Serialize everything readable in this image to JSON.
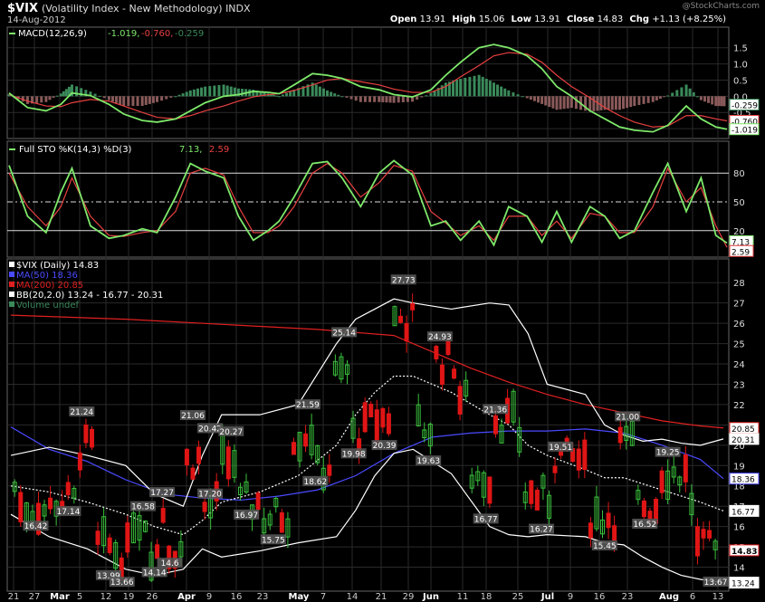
{
  "header": {
    "symbol": "$VIX",
    "name": "(Volatility Index - New Methodology)",
    "exchange": "INDX",
    "date": "14-Aug-2012",
    "open_label": "Open",
    "open": "13.91",
    "high_label": "High",
    "high": "15.06",
    "low_label": "Low",
    "low": "13.91",
    "close_label": "Close",
    "close": "14.83",
    "chg_label": "Chg",
    "chg": "+1.13 (+8.25%)",
    "watermark": "@StockCharts.com"
  },
  "macd_panel": {
    "label": "MACD(12,26,9)",
    "v1": "-1.019,",
    "v2": "-0.760,",
    "v3": "-0.259",
    "ticks": [
      "1.5",
      "1.0",
      "0.5",
      "0.0",
      "-0.5",
      "-1.0"
    ],
    "tags": [
      "-0.259",
      "-0.760",
      "-1.019"
    ]
  },
  "sto_panel": {
    "label": "Full STO %K(14,3) %D(3)",
    "v1": "7.13,",
    "v2": "2.59",
    "ticks": [
      "80",
      "50",
      "20"
    ],
    "tags": [
      "7.13",
      "2.59"
    ]
  },
  "price_panel": {
    "legend": [
      "$VIX (Daily) 14.83",
      "MA(50) 18.36",
      "MA(200) 20.85",
      "BB(20,2.0) 13.24 - 16.77 - 20.31",
      "Volume undef"
    ],
    "tags": [
      "20.85",
      "20.31",
      "18.36",
      "16.77",
      "14.83",
      "13.24"
    ]
  },
  "x_labels": [
    "21",
    "27",
    "Mar",
    "5",
    "12",
    "19",
    "26",
    "Apr",
    "9",
    "16",
    "23",
    "May",
    "7",
    "14",
    "21",
    "29",
    "Jun",
    "11",
    "18",
    "25",
    "Jul",
    "9",
    "16",
    "23",
    "Aug",
    "6",
    "13"
  ],
  "colors": {
    "up": "#39c03b",
    "down": "#e01515",
    "macd": "#7ee86a",
    "signal": "#e84040",
    "ma50": "#4a4aff",
    "ma200": "#e02020",
    "bb": "#ffffff",
    "hist": "#3a8a5a"
  },
  "chart_data": [
    {
      "type": "line",
      "title": "MACD(12,26,9)",
      "x": [
        0,
        5,
        10,
        14,
        17,
        22,
        27,
        31,
        36,
        40,
        45,
        49,
        53,
        58,
        62,
        66,
        70,
        73,
        77,
        82,
        86,
        90,
        95,
        100,
        104,
        109,
        114,
        118,
        122,
        127,
        131,
        135,
        140,
        144,
        148,
        152,
        157,
        161,
        165,
        169,
        174,
        178,
        183,
        187,
        191,
        194
      ],
      "series": [
        {
          "name": "MACD",
          "values": [
            0.1,
            -0.35,
            -0.45,
            -0.25,
            0.1,
            0.02,
            -0.25,
            -0.55,
            -0.75,
            -0.8,
            -0.7,
            -0.45,
            -0.2,
            0.0,
            0.05,
            0.15,
            0.12,
            0.08,
            0.35,
            0.7,
            0.65,
            0.55,
            0.3,
            0.2,
            0.05,
            -0.02,
            0.2,
            0.65,
            1.05,
            1.5,
            1.6,
            1.5,
            1.25,
            0.85,
            0.3,
            0.0,
            -0.45,
            -0.7,
            -0.95,
            -1.05,
            -1.1,
            -0.9,
            -0.3,
            -0.7,
            -0.95,
            -1.019
          ]
        },
        {
          "name": "Signal",
          "values": [
            0.05,
            -0.15,
            -0.3,
            -0.32,
            -0.2,
            -0.1,
            -0.15,
            -0.3,
            -0.5,
            -0.65,
            -0.7,
            -0.6,
            -0.45,
            -0.3,
            -0.15,
            -0.02,
            0.05,
            0.08,
            0.18,
            0.35,
            0.5,
            0.55,
            0.45,
            0.35,
            0.22,
            0.12,
            0.12,
            0.3,
            0.6,
            0.95,
            1.25,
            1.35,
            1.3,
            1.05,
            0.65,
            0.3,
            -0.05,
            -0.35,
            -0.6,
            -0.8,
            -0.95,
            -0.92,
            -0.6,
            -0.6,
            -0.7,
            -0.76
          ]
        }
      ],
      "ylim": [
        -1.25,
        1.8
      ]
    },
    {
      "type": "line",
      "title": "Full STO %K(14,3) %D(3)",
      "x": [
        0,
        5,
        10,
        14,
        17,
        22,
        27,
        31,
        36,
        40,
        45,
        49,
        53,
        58,
        62,
        66,
        70,
        73,
        77,
        82,
        86,
        90,
        95,
        100,
        104,
        109,
        114,
        118,
        122,
        127,
        131,
        135,
        140,
        144,
        148,
        152,
        157,
        161,
        165,
        169,
        174,
        178,
        183,
        187,
        191,
        194
      ],
      "series": [
        {
          "name": "%K",
          "values": [
            88,
            35,
            18,
            60,
            85,
            25,
            12,
            15,
            22,
            18,
            55,
            90,
            82,
            75,
            35,
            10,
            20,
            30,
            55,
            90,
            92,
            75,
            45,
            80,
            93,
            78,
            25,
            30,
            10,
            30,
            5,
            45,
            35,
            8,
            40,
            8,
            45,
            35,
            12,
            20,
            60,
            90,
            40,
            75,
            15,
            7.13
          ]
        },
        {
          "name": "%D",
          "values": [
            80,
            45,
            25,
            45,
            75,
            35,
            15,
            14,
            18,
            20,
            40,
            80,
            85,
            78,
            45,
            18,
            18,
            25,
            45,
            80,
            90,
            80,
            55,
            70,
            88,
            82,
            40,
            28,
            15,
            25,
            10,
            35,
            35,
            15,
            30,
            12,
            38,
            35,
            18,
            18,
            45,
            85,
            50,
            65,
            25,
            2.59
          ]
        }
      ],
      "ylim": [
        0,
        100
      ]
    },
    {
      "type": "candlestick",
      "title": "$VIX (Daily) 14.83",
      "x_ticks": [
        "21",
        "27",
        "Mar",
        "5",
        "12",
        "19",
        "26",
        "Apr",
        "9",
        "16",
        "23",
        "May",
        "7",
        "14",
        "21",
        "29",
        "Jun",
        "11",
        "18",
        "25",
        "Jul",
        "9",
        "16",
        "23",
        "Aug",
        "6",
        "13"
      ],
      "annotations": [
        {
          "label": "21.24",
          "x": 37,
          "y": 21.24
        },
        {
          "label": "17.14",
          "x": 30,
          "y": 17.14
        },
        {
          "label": "16.42",
          "x": 13,
          "y": 16.42
        },
        {
          "label": "13.99",
          "x": 51,
          "y": 13.99
        },
        {
          "label": "13.66",
          "x": 58,
          "y": 13.66
        },
        {
          "label": "16.58",
          "x": 69,
          "y": 16.58
        },
        {
          "label": "14.14",
          "x": 75,
          "y": 14.14
        },
        {
          "label": "17.27",
          "x": 79,
          "y": 17.27
        },
        {
          "label": "14.6",
          "x": 83,
          "y": 14.6
        },
        {
          "label": "21.06",
          "x": 95,
          "y": 21.06
        },
        {
          "label": "17.20",
          "x": 104,
          "y": 17.2
        },
        {
          "label": "20.42",
          "x": 104,
          "y": 20.42
        },
        {
          "label": "20.27",
          "x": 115,
          "y": 20.27
        },
        {
          "label": "16.97",
          "x": 123,
          "y": 16.97
        },
        {
          "label": "15.75",
          "x": 137,
          "y": 15.75
        },
        {
          "label": "21.59",
          "x": 155,
          "y": 21.59
        },
        {
          "label": "18.62",
          "x": 159,
          "y": 18.62
        },
        {
          "label": "19.98",
          "x": 179,
          "y": 19.98
        },
        {
          "label": "25.14",
          "x": 174,
          "y": 25.14
        },
        {
          "label": "20.39",
          "x": 195,
          "y": 20.39
        },
        {
          "label": "27.73",
          "x": 205,
          "y": 27.73
        },
        {
          "label": "24.93",
          "x": 224,
          "y": 24.93
        },
        {
          "label": "19.63",
          "x": 218,
          "y": 19.63
        },
        {
          "label": "16.77",
          "x": 248,
          "y": 16.77
        },
        {
          "label": "21.36",
          "x": 253,
          "y": 21.36
        },
        {
          "label": "16.27",
          "x": 277,
          "y": 16.27
        },
        {
          "label": "19.51",
          "x": 287,
          "y": 19.51
        },
        {
          "label": "15.45",
          "x": 310,
          "y": 15.45
        },
        {
          "label": "21.00",
          "x": 322,
          "y": 21.0
        },
        {
          "label": "16.52",
          "x": 331,
          "y": 16.52
        },
        {
          "label": "19.25",
          "x": 343,
          "y": 19.25
        },
        {
          "label": "13.67",
          "x": 368,
          "y": 13.67
        }
      ],
      "series": [
        {
          "name": "MA(50)",
          "x": [
            0,
            20,
            40,
            60,
            80,
            100,
            120,
            140,
            160,
            180,
            200,
            220,
            240,
            260,
            280,
            300,
            320,
            340,
            360,
            372
          ],
          "values": [
            20.9,
            19.8,
            19.2,
            18.3,
            17.6,
            17.4,
            17.3,
            17.5,
            17.8,
            18.5,
            19.6,
            20.4,
            20.6,
            20.7,
            20.7,
            20.8,
            20.6,
            20.0,
            19.3,
            18.36
          ]
        },
        {
          "name": "MA(200)",
          "x": [
            0,
            60,
            120,
            160,
            200,
            220,
            240,
            260,
            280,
            300,
            320,
            340,
            360,
            372
          ],
          "values": [
            26.4,
            26.2,
            25.9,
            25.7,
            25.4,
            24.6,
            23.8,
            23.1,
            22.5,
            22.0,
            21.6,
            21.2,
            20.95,
            20.85
          ]
        },
        {
          "name": "BB upper",
          "x": [
            0,
            20,
            40,
            60,
            75,
            90,
            100,
            110,
            130,
            150,
            170,
            180,
            190,
            200,
            210,
            230,
            250,
            260,
            270,
            280,
            300,
            310,
            320,
            330,
            340,
            350,
            360,
            372
          ],
          "values": [
            19.5,
            19.9,
            19.5,
            19.0,
            17.6,
            17.0,
            19.5,
            21.5,
            21.5,
            22.0,
            25.0,
            26.2,
            26.7,
            27.2,
            27.0,
            26.7,
            27.0,
            26.9,
            25.5,
            23.0,
            22.5,
            21.0,
            20.5,
            20.2,
            20.3,
            20.1,
            20.0,
            20.31
          ]
        },
        {
          "name": "BB middle",
          "x": [
            0,
            20,
            40,
            60,
            75,
            90,
            100,
            110,
            130,
            150,
            170,
            180,
            190,
            200,
            210,
            230,
            250,
            260,
            270,
            280,
            300,
            310,
            320,
            330,
            340,
            350,
            360,
            372
          ],
          "values": [
            18.0,
            17.7,
            17.2,
            16.6,
            16.0,
            15.6,
            16.3,
            17.2,
            17.7,
            18.5,
            20.0,
            21.5,
            22.6,
            23.4,
            23.4,
            22.6,
            21.5,
            21.0,
            20.0,
            19.5,
            18.8,
            18.4,
            18.4,
            18.1,
            17.8,
            17.5,
            17.2,
            16.77
          ]
        },
        {
          "name": "BB lower",
          "x": [
            0,
            20,
            40,
            60,
            75,
            90,
            100,
            110,
            130,
            150,
            170,
            180,
            190,
            200,
            210,
            230,
            250,
            260,
            270,
            280,
            300,
            310,
            320,
            330,
            340,
            350,
            360,
            372
          ],
          "values": [
            16.6,
            15.5,
            14.9,
            13.9,
            13.6,
            13.9,
            14.9,
            14.5,
            14.8,
            15.2,
            15.5,
            16.8,
            18.5,
            19.6,
            19.8,
            18.6,
            16.0,
            15.6,
            15.5,
            15.6,
            15.5,
            15.2,
            15.1,
            14.5,
            14.0,
            13.6,
            13.4,
            13.24
          ]
        }
      ],
      "ylim": [
        13,
        28.5
      ]
    }
  ]
}
